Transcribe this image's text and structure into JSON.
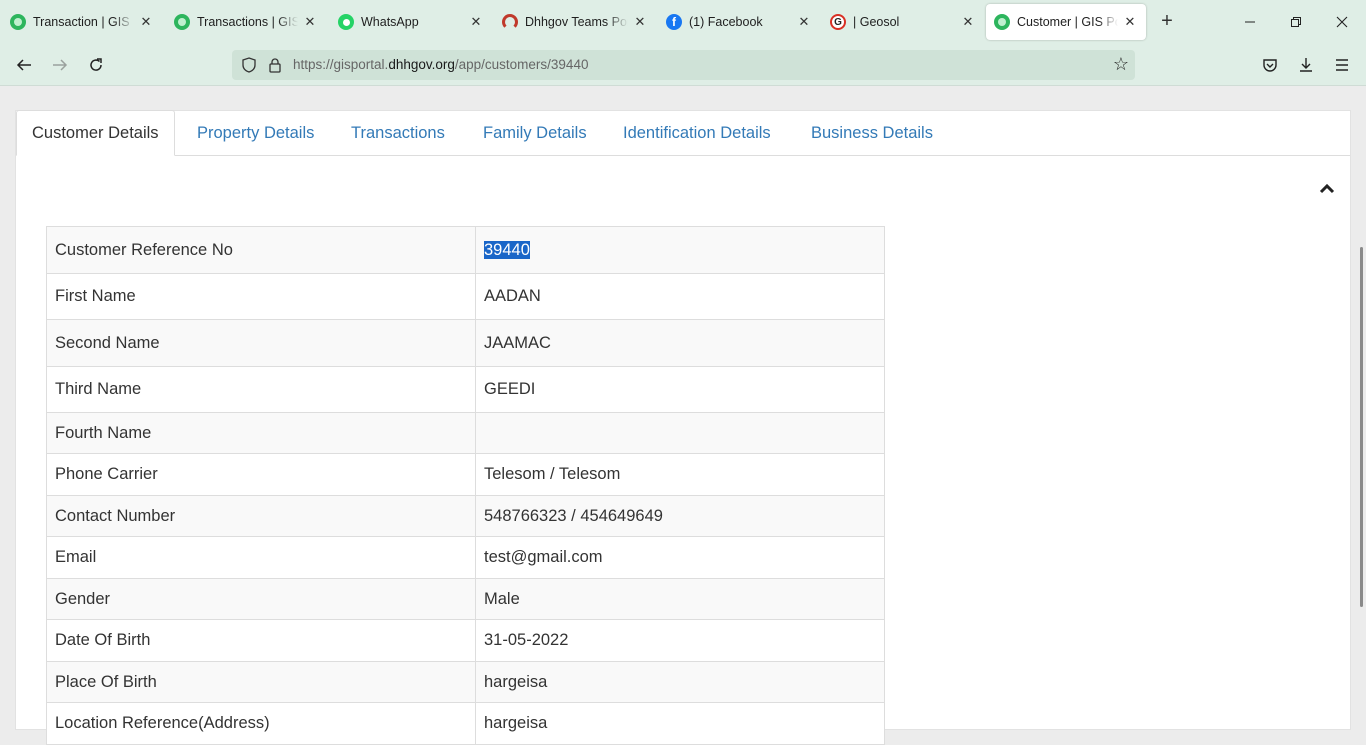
{
  "browser": {
    "tabs": [
      {
        "title": "Transaction | GIS Portal",
        "icon": "gis-leaf-icon"
      },
      {
        "title": "Transactions | GIS Portal",
        "icon": "gis-leaf-icon"
      },
      {
        "title": "WhatsApp",
        "icon": "whatsapp-icon"
      },
      {
        "title": "Dhhgov Teams Portal",
        "icon": "dhhgov-icon"
      },
      {
        "title": "(1) Facebook",
        "icon": "facebook-icon"
      },
      {
        "title": "| Geosol",
        "icon": "geosol-icon"
      },
      {
        "title": "Customer | GIS Portal",
        "icon": "gis-leaf-icon",
        "active": true
      }
    ],
    "url_prefix": "https://gisportal.",
    "url_host": "dhhgov.org",
    "url_path": "/app/customers/39440"
  },
  "page": {
    "tabs": [
      {
        "label": "Customer Details",
        "active": true
      },
      {
        "label": "Property Details"
      },
      {
        "label": "Transactions"
      },
      {
        "label": "Family Details"
      },
      {
        "label": "Identification Details"
      },
      {
        "label": "Business Details"
      }
    ],
    "details": [
      {
        "label": "Customer Reference No",
        "value": "39440",
        "selected": true
      },
      {
        "label": "First Name",
        "value": "AADAN"
      },
      {
        "label": "Second Name",
        "value": "JAAMAC"
      },
      {
        "label": "Third Name",
        "value": "GEEDI"
      },
      {
        "label": "Fourth Name",
        "value": ""
      },
      {
        "label": "Phone Carrier",
        "value": "Telesom / Telesom"
      },
      {
        "label": "Contact Number",
        "value": "548766323 / 454649649"
      },
      {
        "label": "Email",
        "value": "test@gmail.com"
      },
      {
        "label": "Gender",
        "value": "Male"
      },
      {
        "label": "Date Of Birth",
        "value": "31-05-2022"
      },
      {
        "label": "Place Of Birth",
        "value": "hargeisa"
      },
      {
        "label": "Location Reference(Address)",
        "value": "hargeisa"
      }
    ]
  },
  "colors": {
    "browser_chrome": "#dfeee6",
    "link": "#337ab7",
    "selection": "#1a66c8"
  }
}
